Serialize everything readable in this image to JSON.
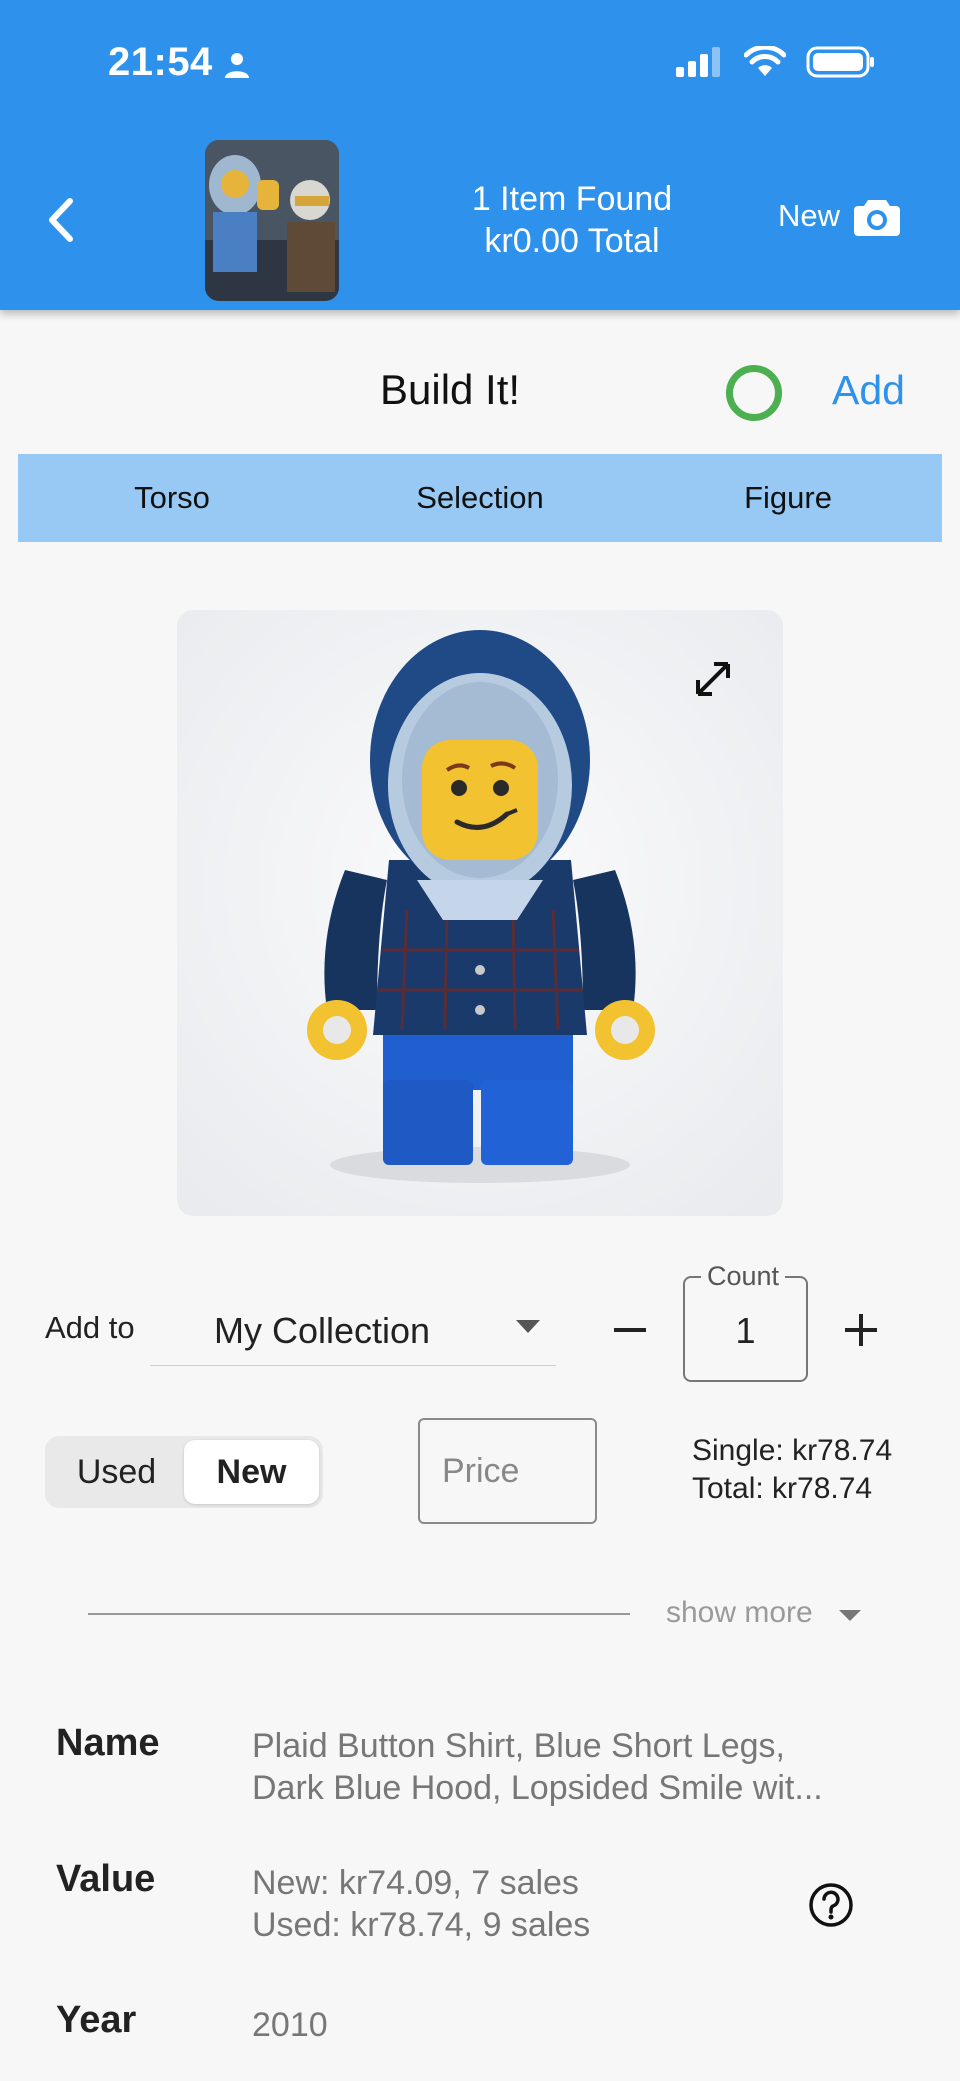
{
  "status_bar": {
    "time": "21:54"
  },
  "header": {
    "found_line1": "1 Item Found",
    "found_line2": "kr0.00 Total",
    "new_label": "New"
  },
  "build": {
    "title": "Build It!",
    "add_label": "Add"
  },
  "tabs": [
    {
      "label": "Torso"
    },
    {
      "label": "Selection"
    },
    {
      "label": "Figure"
    }
  ],
  "add_to": {
    "label": "Add to",
    "collection": "My Collection",
    "count_label": "Count",
    "count": "1"
  },
  "condition": {
    "options": [
      "Used",
      "New"
    ],
    "selected": "New"
  },
  "price": {
    "placeholder": "Price"
  },
  "totals": {
    "single": "Single: kr78.74",
    "total": "Total: kr78.74"
  },
  "show_more": "show more",
  "details": {
    "name_key": "Name",
    "name_value_line1": "Plaid Button Shirt, Blue Short Legs,",
    "name_value_line2": "Dark Blue Hood, Lopsided Smile wit...",
    "value_key": "Value",
    "value_new": "New: kr74.09, 7 sales",
    "value_used": "Used: kr78.74, 9 sales",
    "year_key": "Year",
    "year_value": "2010"
  },
  "colors": {
    "header": "#2e92ec",
    "tabs": "#97c9f4",
    "accent": "#2e92ec",
    "indicator": "#4caf50"
  }
}
